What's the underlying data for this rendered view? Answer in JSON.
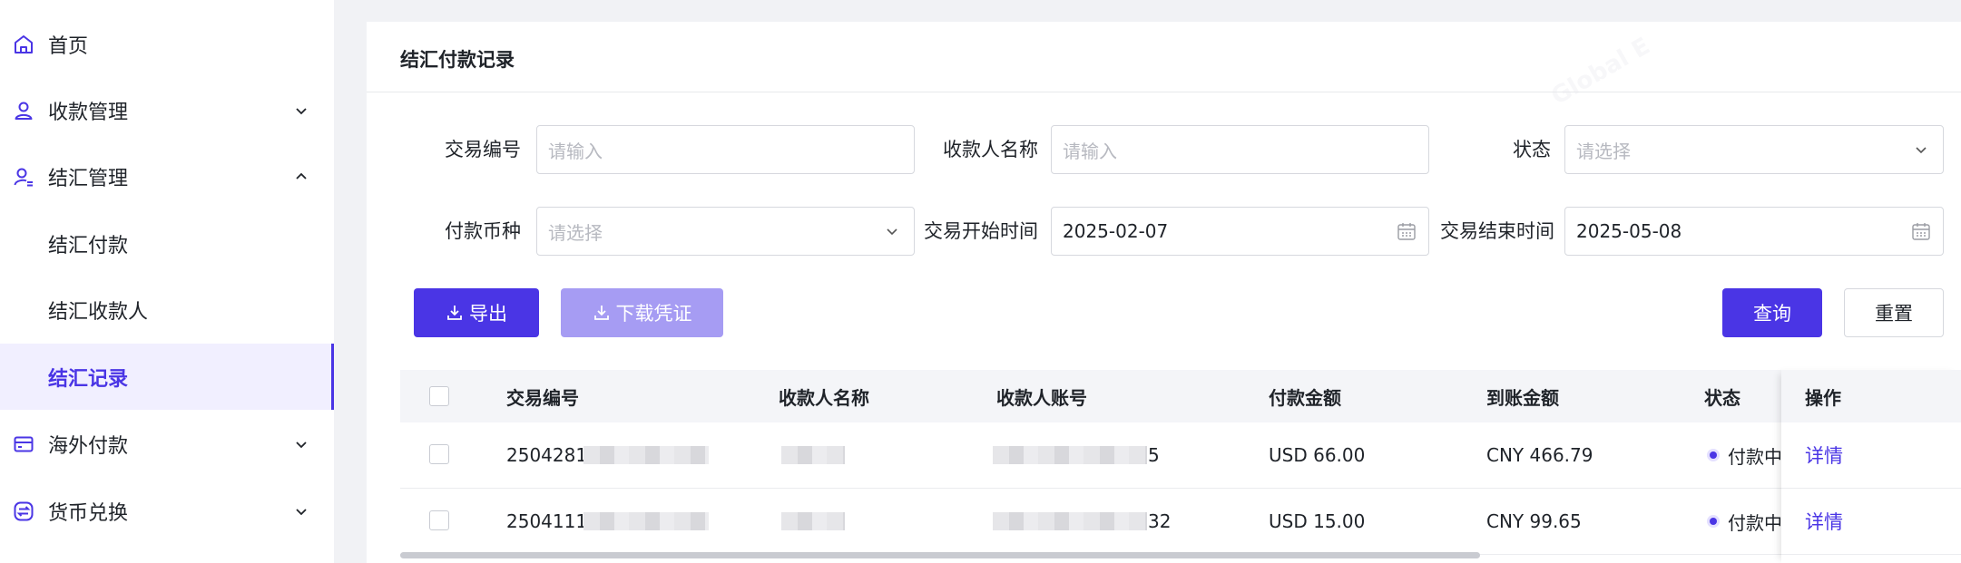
{
  "sidebar": {
    "items": [
      {
        "label": "首页",
        "icon": "home-icon"
      },
      {
        "label": "收款管理",
        "icon": "user-icon"
      },
      {
        "label": "结汇管理",
        "icon": "user-list-icon"
      },
      {
        "label": "海外付款",
        "icon": "card-icon"
      },
      {
        "label": "货币兑换",
        "icon": "exchange-icon"
      }
    ],
    "sub_items": [
      {
        "label": "结汇付款"
      },
      {
        "label": "结汇收款人"
      },
      {
        "label": "结汇记录"
      }
    ]
  },
  "page": {
    "title": "结汇付款记录",
    "watermark": "Global E"
  },
  "filters": {
    "txn_no": {
      "label": "交易编号",
      "placeholder": "请输入"
    },
    "payee_name": {
      "label": "收款人名称",
      "placeholder": "请输入"
    },
    "status": {
      "label": "状态",
      "placeholder": "请选择"
    },
    "currency": {
      "label": "付款币种",
      "placeholder": "请选择"
    },
    "start_time": {
      "label": "交易开始时间",
      "value": "2025-02-07"
    },
    "end_time": {
      "label": "交易结束时间",
      "value": "2025-05-08"
    }
  },
  "actions": {
    "export": "导出",
    "download": "下载凭证",
    "query": "查询",
    "reset": "重置"
  },
  "table": {
    "columns": [
      "交易编号",
      "收款人名称",
      "收款人账号",
      "付款金额",
      "到账金额",
      "状态",
      "操作"
    ],
    "rows": [
      {
        "txn_no": "2504281",
        "account_tail": "5",
        "pay_amount": "USD 66.00",
        "recv_amount": "CNY 466.79",
        "status": "付款中",
        "action": "详情"
      },
      {
        "txn_no": "2504111",
        "account_tail": "32",
        "pay_amount": "USD 15.00",
        "recv_amount": "CNY 99.65",
        "status": "付款中",
        "action": "详情"
      }
    ]
  },
  "colors": {
    "accent": "#4a35e5",
    "accent_disabled": "#a69cf3",
    "sidebar_active_bg": "#f1efff"
  }
}
